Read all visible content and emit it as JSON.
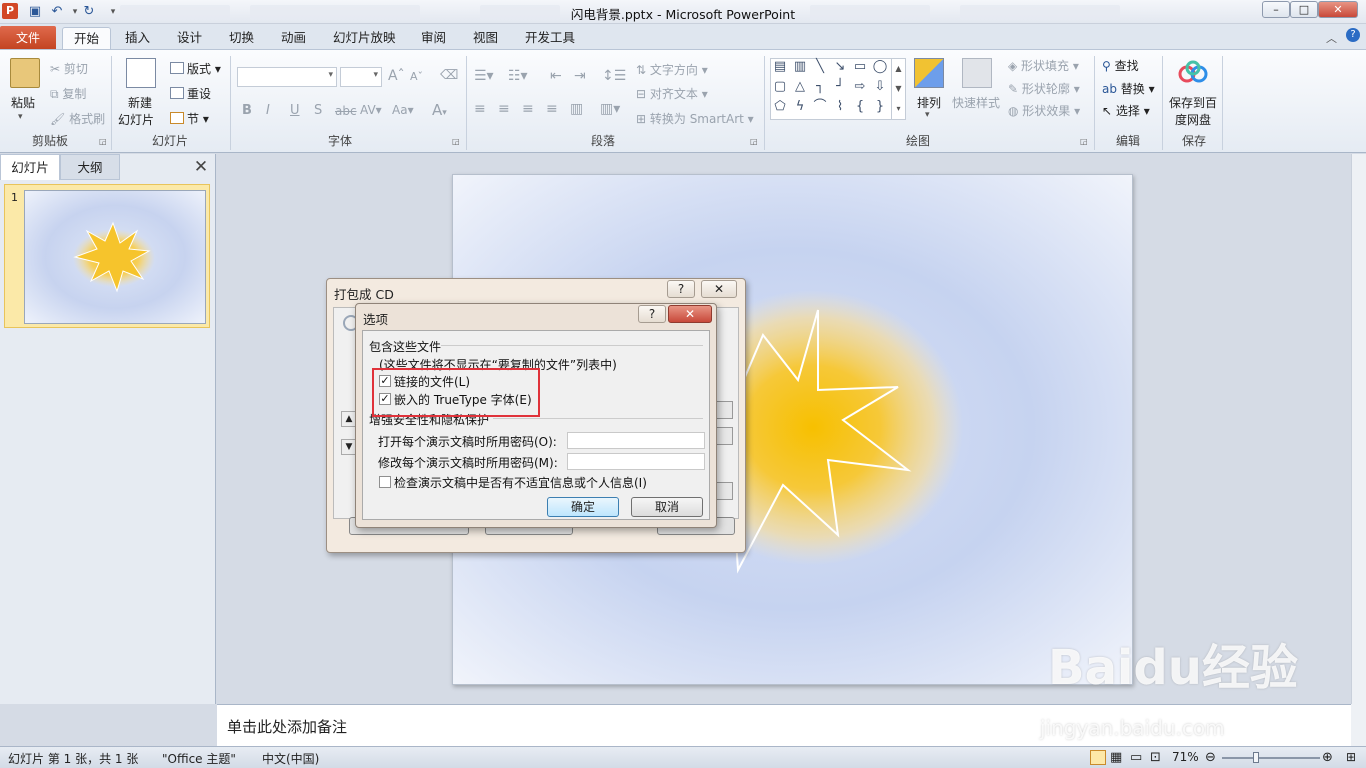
{
  "window": {
    "title": "闪电背景.pptx - Microsoft PowerPoint",
    "logo": "P",
    "minimize": "–",
    "maximize": "□",
    "close": "✕"
  },
  "quick_access": {
    "save_icon": "save-icon",
    "undo_icon": "undo-icon",
    "redo_icon": "redo-icon"
  },
  "tabs": [
    "文件",
    "开始",
    "插入",
    "设计",
    "切换",
    "动画",
    "幻灯片放映",
    "审阅",
    "视图",
    "开发工具"
  ],
  "active_tab": "开始",
  "ribbon": {
    "clipboard": {
      "label": "剪贴板",
      "paste": "粘贴",
      "cut": "剪切",
      "copy": "复制",
      "format_painter": "格式刷"
    },
    "slides": {
      "label": "幻灯片",
      "new_slide_1": "新建",
      "new_slide_2": "幻灯片",
      "layout": "版式",
      "reset": "重设",
      "section": "节"
    },
    "font": {
      "label": "字体",
      "bold": "B",
      "italic": "I",
      "underline": "U",
      "strike": "S",
      "abc": "abc",
      "spacing": "AV",
      "case": "Aa",
      "grow": "A",
      "color": "A"
    },
    "paragraph": {
      "label": "段落",
      "text_direction": "文字方向",
      "align_text": "对齐文本",
      "smartart": "转换为 SmartArt"
    },
    "drawing": {
      "label": "绘图",
      "arrange": "排列",
      "quick_styles": "快速样式",
      "shape_fill": "形状填充",
      "shape_outline": "形状轮廓",
      "shape_effects": "形状效果"
    },
    "editing": {
      "label": "编辑",
      "find": "查找",
      "replace": "替换",
      "select": "选择"
    },
    "save": {
      "label": "保存",
      "save_baidu_1": "保存到百",
      "save_baidu_2": "度网盘"
    }
  },
  "left_pane": {
    "tab_slides": "幻灯片",
    "tab_outline": "大纲",
    "close": "✕",
    "slide_number": "1"
  },
  "notes": {
    "placeholder": "单击此处添加备注"
  },
  "status_bar": {
    "slide_info": "幻灯片 第 1 张，共 1 张",
    "theme": "\"Office 主题\"",
    "language": "中文(中国)",
    "zoom": "71%"
  },
  "dialog_package_cd": {
    "title": "打包成 CD",
    "help": "?",
    "close": "✕"
  },
  "dialog_options": {
    "title": "选项",
    "help": "?",
    "close": "✕",
    "section_include": "包含这些文件",
    "note": "(这些文件将不显示在“要复制的文件”列表中)",
    "linked_files": "链接的文件(L)",
    "linked_files_checked": true,
    "embedded_fonts": "嵌入的 TrueType 字体(E)",
    "embedded_fonts_checked": true,
    "section_security": "增强安全性和隐私保护",
    "open_password_label": "打开每个演示文稿时所用密码(O):",
    "open_password_value": "",
    "modify_password_label": "修改每个演示文稿时所用密码(M):",
    "modify_password_value": "",
    "inspect_label": "检查演示文稿中是否有不适宜信息或个人信息(I)",
    "inspect_checked": false,
    "ok": "确定",
    "cancel": "取消"
  },
  "watermark": {
    "logo": "Baidu经验",
    "url": "jingyan.baidu.com"
  },
  "colors": {
    "file_tab": "#c2421f",
    "highlight_box": "#e0323a",
    "lightning_glow": "#f7c000"
  }
}
